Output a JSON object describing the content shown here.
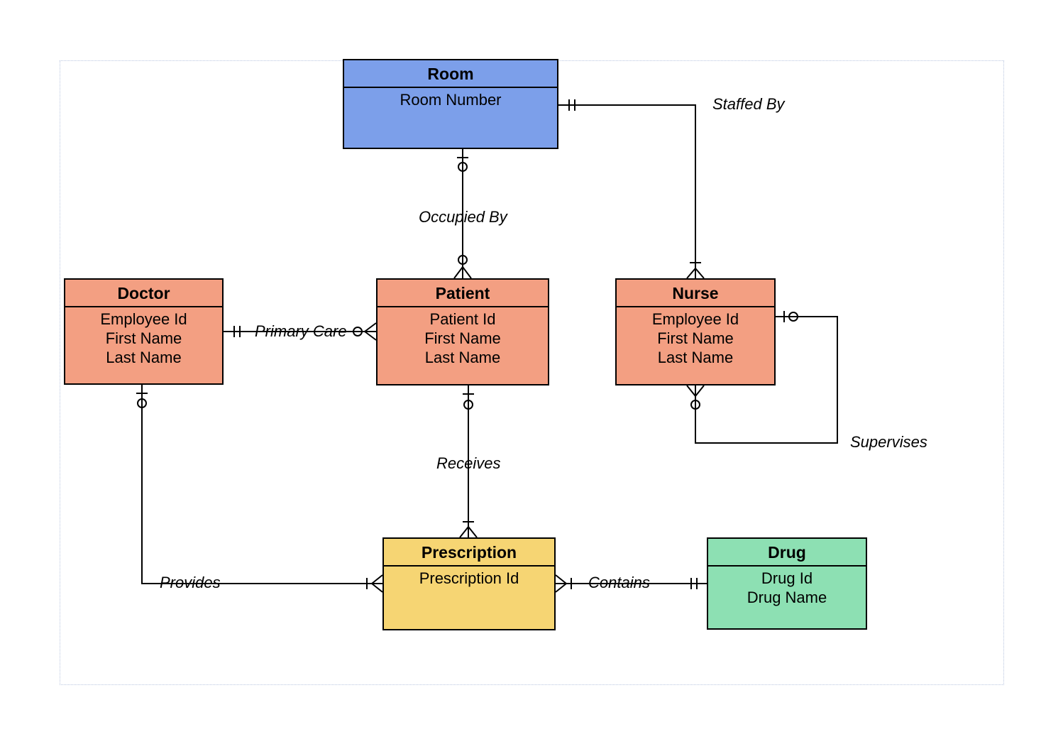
{
  "entities": {
    "room": {
      "name": "Room",
      "attrs": [
        "Room Number"
      ]
    },
    "doctor": {
      "name": "Doctor",
      "attrs": [
        "Employee Id",
        "First Name",
        "Last Name"
      ]
    },
    "patient": {
      "name": "Patient",
      "attrs": [
        "Patient Id",
        "First Name",
        "Last Name"
      ]
    },
    "nurse": {
      "name": "Nurse",
      "attrs": [
        "Employee Id",
        "First Name",
        "Last Name"
      ]
    },
    "prescription": {
      "name": "Prescription",
      "attrs": [
        "Prescription Id"
      ]
    },
    "drug": {
      "name": "Drug",
      "attrs": [
        "Drug Id",
        "Drug Name"
      ]
    }
  },
  "relationships": {
    "staffed_by": {
      "label": "Staffed By"
    },
    "occupied_by": {
      "label": "Occupied By"
    },
    "primary_care": {
      "label": "Primary Care"
    },
    "receives": {
      "label": "Receives"
    },
    "provides": {
      "label": "Provides"
    },
    "contains": {
      "label": "Contains"
    },
    "supervises": {
      "label": "Supervises"
    }
  }
}
